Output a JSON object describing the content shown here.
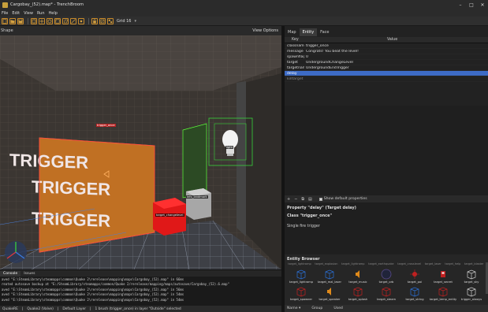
{
  "window": {
    "title": "Cargobay_(52).map* - TrenchBroom",
    "controls": [
      "–",
      "□",
      "✕"
    ]
  },
  "menu": [
    "File",
    "Edit",
    "View",
    "Run",
    "Help"
  ],
  "toolbar": {
    "grid_label": "Grid 16",
    "grid_dropdown": "▾"
  },
  "viewport": {
    "shape_label": "Shape",
    "view_options": "View Options",
    "wall_text": "TRIGGER",
    "labels": {
      "trigger_once": "trigger_once",
      "light": "light",
      "info_landmark": "info_landmark",
      "target_changelevel": "target_changelevel"
    }
  },
  "inspector": {
    "tabs": [
      "Map",
      "Entity",
      "Face"
    ],
    "active_tab": "Entity",
    "table_headers": {
      "key": "Key",
      "value": "Value"
    },
    "rows": [
      {
        "key": "classname",
        "value": "trigger_once",
        "state": "normal"
      },
      {
        "key": "message",
        "value": "Congrats! You beat the level!",
        "state": "normal"
      },
      {
        "key": "spawnflags",
        "value": "0",
        "state": "normal"
      },
      {
        "key": "target",
        "value": "UndergroundChangeLevel",
        "state": "normal"
      },
      {
        "key": "targetname",
        "value": "UndergroundEndTrigger",
        "state": "normal"
      },
      {
        "key": "delay",
        "value": "",
        "state": "selected"
      },
      {
        "key": "killtarget",
        "value": "",
        "state": "dim"
      }
    ],
    "controls": {
      "add": "+",
      "remove": "−",
      "copy": "⧉",
      "paste": "▤",
      "show_default_label": "Show default properties"
    },
    "property_doc": {
      "property": "Property \"delay\" (Target delay)",
      "class": "Class \"trigger_once\"",
      "desc": "Single fire trigger"
    }
  },
  "entity_browser": {
    "title": "Entity Browser",
    "top_labels": [
      "target_lightramp",
      "target_explosion",
      "target_lightramp",
      "target_earthquake",
      "target_crosslevel",
      "target_laser",
      "target_help",
      "target_blaster"
    ],
    "items": [
      {
        "name": "target_lightramp",
        "color": "#2a6fd6",
        "icon": "cube-wire-icon"
      },
      {
        "name": "target_mal_laser",
        "color": "#2a6fd6",
        "icon": "cube-wire-icon"
      },
      {
        "name": "target_music",
        "color": "#e08a1a",
        "icon": "speaker-icon"
      },
      {
        "name": "target_orb",
        "color": "#5a4b8a",
        "icon": "orb-icon"
      },
      {
        "name": "target_poi",
        "color": "#c02020",
        "icon": "poi-icon"
      },
      {
        "name": "target_secret",
        "color": "#c02020",
        "icon": "secret-icon"
      },
      {
        "name": "target_sky",
        "color": "#cccccc",
        "icon": "cube-wire-icon"
      },
      {
        "name": "target_spawner",
        "color": "#c02020",
        "icon": "cube-wire-icon"
      },
      {
        "name": "target_speaker",
        "color": "#e08a1a",
        "icon": "speaker-icon"
      },
      {
        "name": "target_splash",
        "color": "#c02020",
        "icon": "cube-wire-icon"
      },
      {
        "name": "target_steam",
        "color": "#c02020",
        "icon": "cube-wire-icon"
      },
      {
        "name": "target_string",
        "color": "#2a6fd6",
        "icon": "cube-wire-icon"
      },
      {
        "name": "target_temp_entity",
        "color": "#c02020",
        "icon": "cube-wire-icon"
      },
      {
        "name": "trigger_always",
        "color": "#cccccc",
        "icon": "cube-wire-icon"
      }
    ],
    "bottom": [
      "Name ▾",
      "Group",
      "Used"
    ]
  },
  "console": {
    "tabs": [
      "Console",
      "Issues"
    ],
    "lines": [
      "aved \"E:\\SteamLibrary\\steamapps\\common\\Quake 2\\rerelease\\mapping\\maps\\Cargobay_(52).map\" in 66ms",
      "reated autosave backup at \"E:/SteamLibrary/steamapps/common/Quake 2/rerelease/mapping/maps/autosave/Cargobay_(52).6.map\"",
      "aved \"E:\\SteamLibrary\\steamapps\\common\\Quake 2\\rerelease\\mapping\\maps\\Cargobay_(52).map\" in 56ms",
      "aved \"E:\\SteamLibrary\\steamapps\\common\\Quake 2\\rerelease\\mapping\\maps\\Cargobay_(52).map\" in 54ms",
      "aved \"E:\\SteamLibrary\\steamapps\\common\\Quake 2\\rerelease\\mapping\\maps\\Cargobay_(52).map\" in 54ms"
    ]
  },
  "statusbar": [
    "QuakeRE",
    "|",
    "Quake2 (Valve)",
    "|",
    "Default Layer",
    "|",
    "1 brush (trigger_once) in layer \"Outside\" selected"
  ]
}
